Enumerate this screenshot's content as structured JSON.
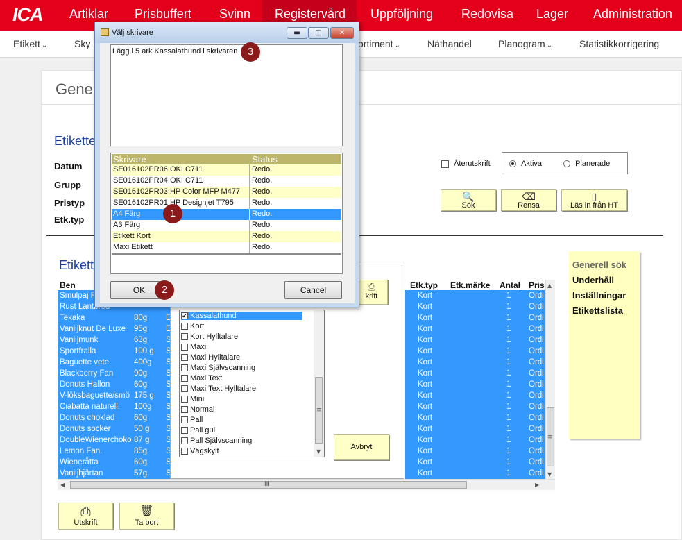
{
  "topnav": {
    "logo": "ICA",
    "items": [
      "Artiklar",
      "Prisbuffert",
      "Svinn",
      "Registervård",
      "Uppföljning",
      "Redovisa",
      "Lager",
      "Administration"
    ]
  },
  "subnav": {
    "items": [
      "Etikett",
      "Sky",
      "ortiment",
      "Näthandel",
      "Planogram",
      "Statistikkorrigering"
    ]
  },
  "panel": {
    "title": "Gene",
    "heading": "Etikette",
    "fields": [
      "Datum",
      "Grupp",
      "Pristyp",
      "Etk.typ"
    ],
    "reprint_label": "Återutskrift",
    "radio_active": "Aktiva",
    "radio_planned": "Planerade",
    "btn_search": "Sök",
    "btn_clear": "Rensa",
    "btn_read": "Läs in från HT"
  },
  "sidebar": {
    "items": [
      "Generell sök",
      "Underhåll",
      "Inställningar",
      "Etikettslista"
    ]
  },
  "table": {
    "heading": "Etikett",
    "col_ben": "Ben",
    "col_etktyp": "Etk.typ",
    "col_etkmarke": "Etk.märke",
    "col_antal": "Antal",
    "col_pris": "Pris",
    "rows": [
      {
        "name": "Smulpaj R",
        "qty": "",
        "c": "",
        "typ": "Kort",
        "antal": "1",
        "pris": "Ordi"
      },
      {
        "name": "Rust Lantbröd",
        "qty": "",
        "c": "",
        "typ": "Kort",
        "antal": "1",
        "pris": "Ordi"
      },
      {
        "name": "Tekaka",
        "qty": "80g",
        "c": "E",
        "typ": "Kort",
        "antal": "1",
        "pris": "Ordi"
      },
      {
        "name": "Vaniljknut De Luxe",
        "qty": "95g",
        "c": "E",
        "typ": "Kort",
        "antal": "1",
        "pris": "Ordi"
      },
      {
        "name": "Vaniljmunk",
        "qty": "63g",
        "c": "S",
        "typ": "Kort",
        "antal": "1",
        "pris": "Ordi"
      },
      {
        "name": "Sportfralla",
        "qty": "100 g",
        "c": "S",
        "typ": "Kort",
        "antal": "1",
        "pris": "Ordi"
      },
      {
        "name": "Baguette vete",
        "qty": "400g",
        "c": "S",
        "typ": "Kort",
        "antal": "1",
        "pris": "Ordi"
      },
      {
        "name": "Blackberry Fan",
        "qty": "90g",
        "c": "S",
        "typ": "Kort",
        "antal": "1",
        "pris": "Ordi"
      },
      {
        "name": "Donuts Hallon",
        "qty": "60g",
        "c": "S",
        "typ": "Kort",
        "antal": "1",
        "pris": "Ordi"
      },
      {
        "name": "V-löksbaguette/smö",
        "qty": "175 g",
        "c": "S",
        "typ": "Kort",
        "antal": "1",
        "pris": "Ordi"
      },
      {
        "name": "Ciabatta naturell.",
        "qty": "100g",
        "c": "S",
        "typ": "Kort",
        "antal": "1",
        "pris": "Ordi"
      },
      {
        "name": "Donuts choklad",
        "qty": "60g",
        "c": "S",
        "typ": "Kort",
        "antal": "1",
        "pris": "Ordi"
      },
      {
        "name": "Donuts socker",
        "qty": "50 g",
        "c": "S",
        "typ": "Kort",
        "antal": "1",
        "pris": "Ordi"
      },
      {
        "name": "DoubleWienerchoko",
        "qty": "87 g",
        "c": "S",
        "typ": "Kort",
        "antal": "1",
        "pris": "Ordi"
      },
      {
        "name": "Lemon Fan.",
        "qty": "85g",
        "c": "S",
        "typ": "Kort",
        "antal": "1",
        "pris": "Ordi"
      },
      {
        "name": "Wieneråtta",
        "qty": "60g",
        "c": "S",
        "typ": "Kort",
        "antal": "1",
        "pris": "Ordi"
      },
      {
        "name": "Vaniljhjärtan",
        "qty": "57g.",
        "c": "S",
        "typ": "Kort",
        "antal": "1",
        "pris": "Ordi"
      }
    ],
    "hscroll_grip": "III"
  },
  "etikettyp": {
    "items": [
      {
        "label": "Kassalathund",
        "checked": true
      },
      {
        "label": "Kort",
        "checked": false
      },
      {
        "label": "Kort Hylltalare",
        "checked": false
      },
      {
        "label": "Maxi",
        "checked": false
      },
      {
        "label": "Maxi Hylltalare",
        "checked": false
      },
      {
        "label": "Maxi Självscanning",
        "checked": false
      },
      {
        "label": "Maxi Text",
        "checked": false
      },
      {
        "label": "Maxi Text Hylltalare",
        "checked": false
      },
      {
        "label": "Mini",
        "checked": false
      },
      {
        "label": "Normal",
        "checked": false
      },
      {
        "label": "Pall",
        "checked": false
      },
      {
        "label": "Pall gul",
        "checked": false
      },
      {
        "label": "Pall Självscanning",
        "checked": false
      },
      {
        "label": "Vägskylt",
        "checked": false
      }
    ],
    "btn_print_partial": "krift",
    "btn_abort": "Avbryt"
  },
  "bottom": {
    "btn_print": "Utskrift",
    "btn_delete": "Ta bort"
  },
  "modal": {
    "title": "Välj skrivare",
    "message": "Lägg i 5 ark Kassalathund i skrivaren",
    "col_printer": "Skrivare",
    "col_status": "Status",
    "printers": [
      {
        "name": "SE016102PR06 OKI C711",
        "status": "Redo.",
        "style": "yellow"
      },
      {
        "name": "SE016102PR04 OKI C711",
        "status": "Redo.",
        "style": "white"
      },
      {
        "name": "SE016102PR03 HP Color MFP M477",
        "status": "Redo.",
        "style": "yellow"
      },
      {
        "name": "SE016102PR01 HP Designjet T795",
        "status": "Redo.",
        "style": "white"
      },
      {
        "name": "A4 Färg",
        "status": "Redo.",
        "style": "sel"
      },
      {
        "name": "A3 Färg",
        "status": "Redo.",
        "style": "white"
      },
      {
        "name": "Etikett Kort",
        "status": "Redo.",
        "style": "yellow"
      },
      {
        "name": "Maxi Etikett",
        "status": "Redo.",
        "style": "white"
      }
    ],
    "ok_label": "OK",
    "cancel_label": "Cancel"
  },
  "badges": [
    "1",
    "2",
    "3"
  ],
  "colors": {
    "brand_red": "#e4001b",
    "selection_blue": "#3399ff",
    "button_yellow": "#ffffc8",
    "badge": "#8b1a1a"
  }
}
